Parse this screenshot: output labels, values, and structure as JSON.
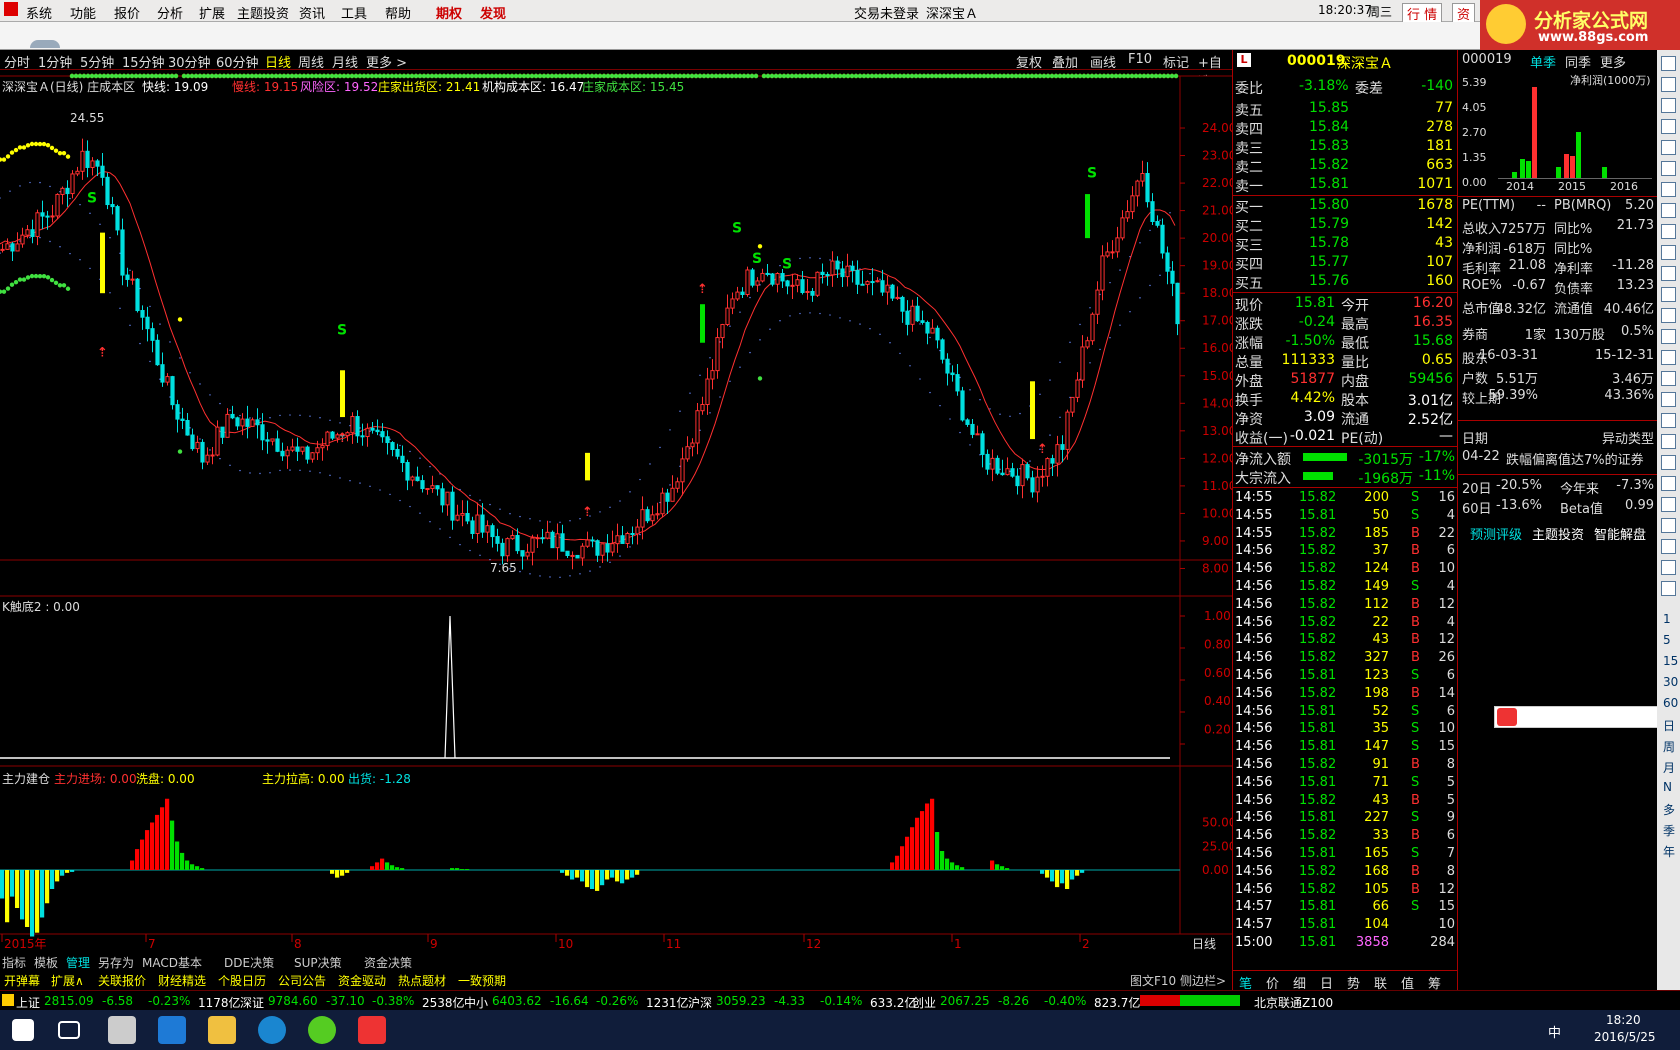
{
  "menubar": {
    "items": [
      "系统",
      "功能",
      "报价",
      "分析",
      "扩展",
      "主题投资",
      "资讯",
      "工具",
      "帮助"
    ],
    "qiquan": "期权",
    "fayang": "发现",
    "login": "交易未登录",
    "stock": "深深宝Ａ",
    "time": "18:20:37",
    "weekday": "周三",
    "quote": "行  情",
    "asset": "资"
  },
  "logo": {
    "brand": "分析家公式网",
    "url": "www.88gs.com"
  },
  "periods": [
    "分时",
    "1分钟",
    "5分钟",
    "15分钟",
    "30分钟",
    "60分钟",
    "日线",
    "周线",
    "月线",
    "更多 >"
  ],
  "chart_tools": [
    "复权",
    "叠加",
    "画线",
    "F10",
    "标记",
    "+自选"
  ],
  "main_legend": {
    "name": "深深宝Ａ(日线) 庄成本区",
    "fast": "快线: 19.09",
    "slow": "慢线: 19.15",
    "risk": "风险区: 19.52",
    "dealer_out": "庄家出货区: 21.41",
    "inst": "机构成本区: 16.47",
    "dealer_cost": "庄家成本区: 15.45"
  },
  "price_axis": [
    "24.00",
    "23.00",
    "22.00",
    "21.00",
    "20.00",
    "19.00",
    "18.00",
    "17.00",
    "16.00",
    "15.00",
    "14.00",
    "13.00",
    "12.00",
    "11.00",
    "10.00",
    "9.00",
    "8.00"
  ],
  "high_label": "24.55",
  "low_label": "7.65",
  "ind1": {
    "legend": "K触底2 : 0.00",
    "axis": [
      "1.00",
      "0.80",
      "0.60",
      "0.40",
      "0.20"
    ]
  },
  "ind2": {
    "name": "主力建仓",
    "enter": "主力进场: 0.00",
    "wash": "洗盘: 0.00",
    "pull": "主力拉高: 0.00",
    "ship": "出货: -1.28",
    "axis": [
      "50.00",
      "25.00",
      "0.00"
    ]
  },
  "time_axis": {
    "labels": [
      "2015年",
      "7",
      "8",
      "9",
      "10",
      "11",
      "12",
      "1",
      "2"
    ],
    "period": "日线"
  },
  "tabs1": [
    "指标",
    "模板",
    "管理",
    "另存为",
    "MACD基本",
    "DDE决策",
    "SUP决策",
    "资金决策"
  ],
  "tabs2": [
    "开弹幕",
    "扩展∧",
    "关联报价",
    "财经精选",
    "个股日历",
    "公司公告",
    "资金驱动",
    "热点题材",
    "一致预期"
  ],
  "tabs2_right": [
    "图文F10",
    "侧边栏>"
  ],
  "rp_tabs": [
    "笔",
    "价",
    "细",
    "日",
    "势",
    "联",
    "值",
    "筹"
  ],
  "quote": {
    "code": "000019",
    "name": "深深宝Ａ",
    "weibi": "-3.18%",
    "weicha": "-140",
    "asks": [
      [
        "卖五",
        "15.85",
        "77"
      ],
      [
        "卖四",
        "15.84",
        "278"
      ],
      [
        "卖三",
        "15.83",
        "181"
      ],
      [
        "卖二",
        "15.82",
        "663"
      ],
      [
        "卖一",
        "15.81",
        "1071"
      ]
    ],
    "bids": [
      [
        "买一",
        "15.80",
        "1678"
      ],
      [
        "买二",
        "15.79",
        "142"
      ],
      [
        "买三",
        "15.78",
        "43"
      ],
      [
        "买四",
        "15.77",
        "107"
      ],
      [
        "买五",
        "15.76",
        "160"
      ]
    ],
    "stats": [
      [
        "现价",
        "15.81",
        "今开",
        "16.20"
      ],
      [
        "涨跌",
        "-0.24",
        "最高",
        "16.35"
      ],
      [
        "涨幅",
        "-1.50%",
        "最低",
        "15.68"
      ],
      [
        "总量",
        "111333",
        "量比",
        "0.65"
      ],
      [
        "外盘",
        "51877",
        "内盘",
        "59456"
      ],
      [
        "换手",
        "4.42%",
        "股本",
        "3.01亿"
      ],
      [
        "净资",
        "3.09",
        "流通",
        "2.52亿"
      ],
      [
        "收益(一)",
        "-0.021",
        "PE(动)",
        "—"
      ]
    ],
    "flows": [
      [
        "净流入额",
        "-3015万",
        "-17%"
      ],
      [
        "大宗流入",
        "-1968万",
        "-11%"
      ]
    ]
  },
  "ticks": [
    [
      "14:55",
      "15.82",
      "200",
      "S",
      "16"
    ],
    [
      "14:55",
      "15.81",
      "50",
      "S",
      "4"
    ],
    [
      "14:55",
      "15.82",
      "185",
      "B",
      "22"
    ],
    [
      "14:56",
      "15.82",
      "37",
      "B",
      "6"
    ],
    [
      "14:56",
      "15.82",
      "124",
      "B",
      "10"
    ],
    [
      "14:56",
      "15.82",
      "149",
      "S",
      "4"
    ],
    [
      "14:56",
      "15.82",
      "112",
      "B",
      "12"
    ],
    [
      "14:56",
      "15.82",
      "22",
      "B",
      "4"
    ],
    [
      "14:56",
      "15.82",
      "43",
      "B",
      "12"
    ],
    [
      "14:56",
      "15.82",
      "327",
      "B",
      "26"
    ],
    [
      "14:56",
      "15.81",
      "123",
      "S",
      "6"
    ],
    [
      "14:56",
      "15.82",
      "198",
      "B",
      "14"
    ],
    [
      "14:56",
      "15.81",
      "52",
      "S",
      "6"
    ],
    [
      "14:56",
      "15.81",
      "35",
      "S",
      "10"
    ],
    [
      "14:56",
      "15.81",
      "147",
      "S",
      "15"
    ],
    [
      "14:56",
      "15.82",
      "91",
      "B",
      "8"
    ],
    [
      "14:56",
      "15.81",
      "71",
      "S",
      "5"
    ],
    [
      "14:56",
      "15.82",
      "43",
      "B",
      "5"
    ],
    [
      "14:56",
      "15.81",
      "227",
      "S",
      "9"
    ],
    [
      "14:56",
      "15.82",
      "33",
      "B",
      "6"
    ],
    [
      "14:56",
      "15.81",
      "165",
      "S",
      "7"
    ],
    [
      "14:56",
      "15.82",
      "168",
      "B",
      "8"
    ],
    [
      "14:56",
      "15.82",
      "105",
      "B",
      "12"
    ],
    [
      "14:57",
      "15.81",
      "66",
      "S",
      "15"
    ],
    [
      "14:57",
      "15.81",
      "104",
      "",
      "10"
    ],
    [
      "15:00",
      "15.81",
      "3858",
      "",
      "284"
    ]
  ],
  "fin": {
    "code": "000019",
    "tabs": [
      "单季",
      "同季",
      "更多"
    ],
    "chart_title": "净利润(1000万)",
    "yaxis": [
      "5.39",
      "4.05",
      "2.70",
      "1.35",
      "0.00"
    ],
    "years": [
      "2014",
      "2015",
      "2016"
    ],
    "rows": [
      [
        "PE(TTM)",
        "--",
        "PB(MRQ)",
        "5.20"
      ],
      [
        "总收入",
        "7257万",
        "同比%",
        "21.73"
      ],
      [
        "净利润",
        "-618万",
        "同比%",
        ""
      ],
      [
        "毛利率",
        "21.08",
        "净利率",
        "-11.28"
      ],
      [
        "ROE%",
        "-0.67",
        "负债率",
        "13.23"
      ],
      [
        "总市值",
        "48.32亿",
        "流通值",
        "40.46亿"
      ],
      [
        "券商",
        "1家",
        "130万股",
        "0.5%"
      ],
      [
        "股东",
        "16-03-31",
        "",
        "15-12-31"
      ],
      [
        "户数",
        "5.51万",
        "",
        "3.46万"
      ],
      [
        "较上期",
        "59.39%",
        "",
        "43.36%"
      ]
    ],
    "event_head": [
      "日期",
      "异动类型"
    ],
    "event": [
      "04-22",
      "跌幅偏离值达7%的证券"
    ],
    "perf": [
      [
        "20日",
        "-20.5%",
        "今年来",
        "-7.3%"
      ],
      [
        "60日",
        "-13.6%",
        "Beta值",
        "0.99"
      ]
    ],
    "links": [
      "预测评级",
      "主题投资",
      "智能解盘"
    ]
  },
  "vtool_labels": [
    "1",
    "5",
    "15",
    "30",
    "60",
    "日",
    "周",
    "月",
    "N",
    "多",
    "季",
    "年"
  ],
  "status": [
    [
      "上证",
      "2815.09",
      "-6.58",
      "-0.23%",
      "1178亿"
    ],
    [
      "深证",
      "9784.60",
      "-37.10",
      "-0.38%",
      "2538亿"
    ],
    [
      "中小",
      "6403.62",
      "-16.64",
      "-0.26%",
      "1231亿"
    ],
    [
      "沪深",
      "3059.23",
      "-4.33",
      "-0.14%",
      "633.2亿"
    ],
    [
      "创业",
      "2067.25",
      "-8.26",
      "-0.40%",
      "823.7亿"
    ]
  ],
  "status_right": "北京联通Z100",
  "taskbar": {
    "time": "18:20",
    "date": "2016/5/25",
    "ime": "中"
  },
  "colors": {
    "up": "#ff3030",
    "down": "#00e0e0",
    "yellow": "#ffff00",
    "green": "#40e040",
    "grid": "#8b0000"
  }
}
